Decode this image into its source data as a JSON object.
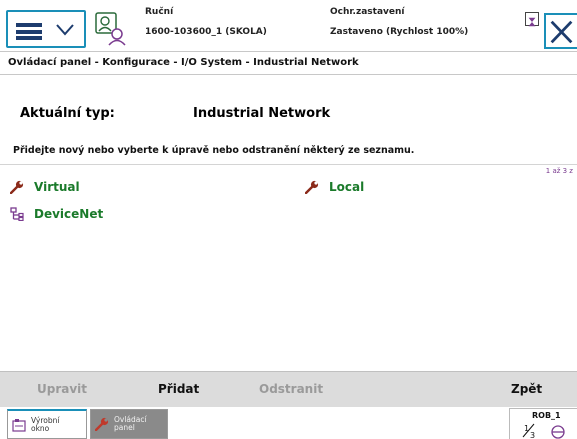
{
  "header": {
    "mode": "Ruční",
    "controller": "1600-103600_1 (SKOLA)",
    "state": "Ochr.zastavení",
    "speed": "Zastaveno (Rychlost 100%)"
  },
  "breadcrumb": "Ovládací panel - Konfigurace - I/O System - Industrial Network",
  "type": {
    "label": "Aktuální typ:",
    "value": "Industrial Network"
  },
  "instruction": "Přidejte nový nebo vyberte k úpravě nebo odstranění některý ze seznamu.",
  "list": {
    "count": "1 až 3 z",
    "items": [
      {
        "label": "Virtual",
        "icon": "wrench-icon"
      },
      {
        "label": "Local",
        "icon": "wrench-icon"
      },
      {
        "label": "DeviceNet",
        "icon": "network-icon"
      }
    ]
  },
  "buttons": {
    "edit": "Upravit",
    "add": "Přidat",
    "remove": "Odstranit",
    "back": "Zpět"
  },
  "taskbar": {
    "production_line1": "Výrobní",
    "production_line2": "okno",
    "panel_line1": "Ovládací",
    "panel_line2": "panel",
    "rob_label": "ROB_1"
  },
  "colors": {
    "accent": "#1a8fb8",
    "item_text": "#1a7a2a",
    "disabled": "#9a9a9a",
    "wrench": "#8b2a1a"
  }
}
